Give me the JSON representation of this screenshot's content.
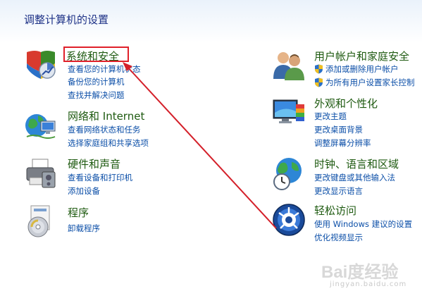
{
  "page": {
    "title": "调整计算机的设置"
  },
  "left": [
    {
      "title": "系统和安全",
      "links": [
        "查看您的计算机状态",
        "备份您的计算机",
        "查找并解决问题"
      ]
    },
    {
      "title": "网络和 Internet",
      "links": [
        "查看网络状态和任务",
        "选择家庭组和共享选项"
      ]
    },
    {
      "title": "硬件和声音",
      "links": [
        "查看设备和打印机",
        "添加设备"
      ]
    },
    {
      "title": "程序",
      "links": [
        "卸载程序"
      ]
    }
  ],
  "right": [
    {
      "title": "用户帐户和家庭安全",
      "links": [
        "添加或删除用户帐户",
        "为所有用户设置家长控制"
      ]
    },
    {
      "title": "外观和个性化",
      "links": [
        "更改主题",
        "更改桌面背景",
        "调整屏幕分辨率"
      ]
    },
    {
      "title": "时钟、语言和区域",
      "links": [
        "更改键盘或其他输入法",
        "更改显示语言"
      ]
    },
    {
      "title": "轻松访问",
      "links": [
        "使用 Windows 建议的设置",
        "优化视频显示"
      ]
    }
  ],
  "icons": {
    "system_security": "shield-chart-icon",
    "network": "globe-network-icon",
    "hardware": "printer-icon",
    "programs": "program-disc-icon",
    "user_accounts": "users-icon",
    "appearance": "monitor-palette-icon",
    "clock_region": "globe-clock-icon",
    "ease_of_access": "accessibility-icon"
  },
  "annotation": {
    "box_color": "#e0202a",
    "arrow_color": "#d4202a"
  },
  "watermark": {
    "logo": "Bai度经验",
    "url": "jingyan.baidu.com"
  }
}
